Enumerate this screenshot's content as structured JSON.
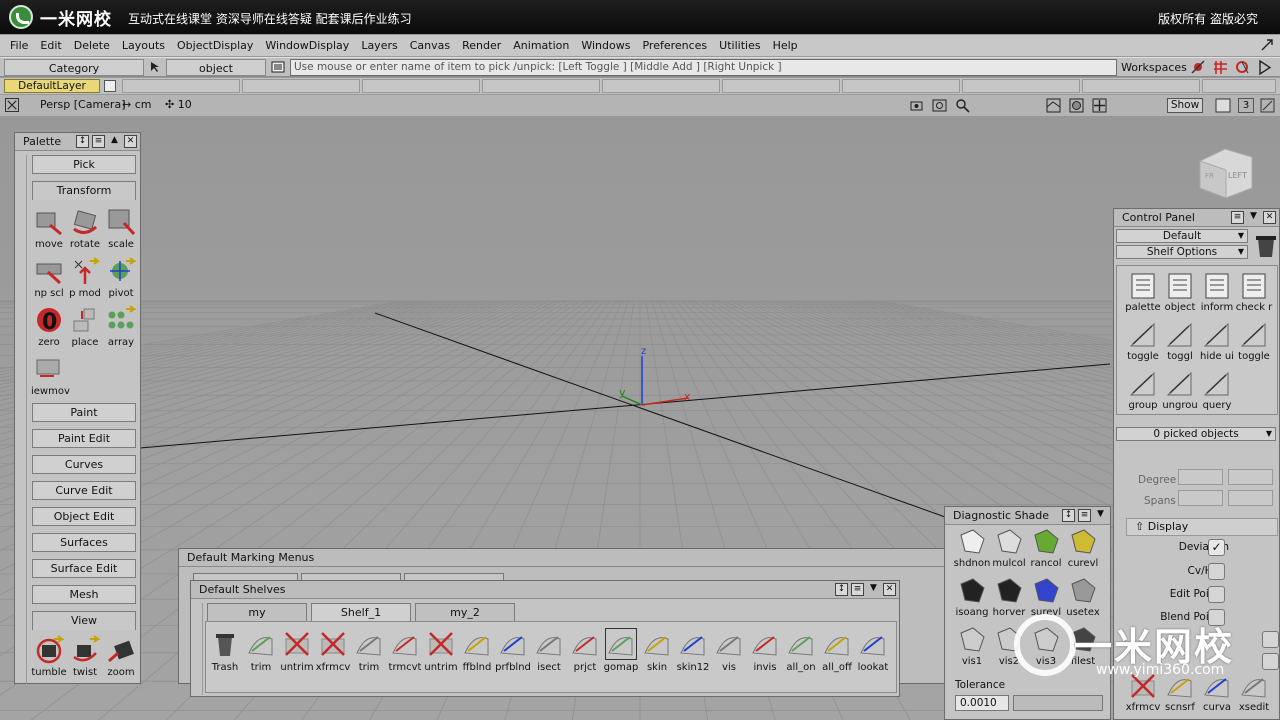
{
  "banner": {
    "brand": "一米网校",
    "slogan": "互动式在线课堂  资深导师在线答疑  配套课后作业练习",
    "copyright": "版权所有 盗版必究"
  },
  "menubar": [
    "File",
    "Edit",
    "Delete",
    "Layouts",
    "ObjectDisplay",
    "WindowDisplay",
    "Layers",
    "Canvas",
    "Render",
    "Animation",
    "Windows",
    "Preferences",
    "Utilities",
    "Help"
  ],
  "pickbar": {
    "category": "Category",
    "object": "object",
    "pick_placeholder": "Use mouse or enter name of item to pick /unpick: [Left Toggle ] [Middle Add ] [Right Unpick ]",
    "workspaces": "Workspaces"
  },
  "layerbar": {
    "default_layer": "DefaultLayer"
  },
  "viewport_header": {
    "camera": "Persp [Camera]",
    "unit": "↔ cm",
    "grid": "10",
    "show": "Show",
    "count": "3"
  },
  "viewport": {
    "axis_x": "x",
    "axis_y": "y",
    "axis_z": "z",
    "view_cube": "LEFT",
    "view_cube_side": "FR"
  },
  "palette": {
    "title": "Palette",
    "sections": {
      "pick": "Pick",
      "transform": "Transform",
      "paint": "Paint",
      "paint_edit": "Paint Edit",
      "curves": "Curves",
      "curve_edit": "Curve Edit",
      "object_edit": "Object Edit",
      "surfaces": "Surfaces",
      "surface_edit": "Surface Edit",
      "mesh": "Mesh",
      "view": "View"
    },
    "transform_tools": [
      "move",
      "rotate",
      "scale",
      "np scl",
      "p mod",
      "pivot",
      "zero",
      "place",
      "array",
      "iewmov"
    ],
    "view_tools": [
      "tumble",
      "twist",
      "zoom"
    ]
  },
  "control_panel": {
    "title": "Control Panel",
    "default": "Default",
    "shelf_options": "Shelf Options",
    "shelf_items": [
      "palette",
      "object",
      "inform",
      "check r",
      "toggle",
      "toggl",
      "hide ui",
      "toggle",
      "group",
      "ungrou",
      "query"
    ],
    "picked": "0 picked objects",
    "degree": "Degree",
    "spans": "Spans",
    "display": "Display",
    "deviation": "Deviation",
    "cv_hull": "Cv/Hull",
    "edit_points": "Edit Points",
    "blend_points": "Blend Points",
    "bottom_tools": [
      "xfrmcv",
      "scnsrf",
      "curva",
      "xsedit"
    ]
  },
  "diagnostic": {
    "title": "Diagnostic Shade",
    "items": [
      "shdnon",
      "mulcol",
      "rancol",
      "curevl",
      "isoang",
      "horver",
      "surevl",
      "usetex",
      "vis1",
      "vis2",
      "vis3",
      "filest"
    ],
    "tolerance_label": "Tolerance",
    "tolerance_value": "0.0010"
  },
  "marking_menus": {
    "title": "Default Marking Menus"
  },
  "shelves": {
    "title": "Default Shelves",
    "tabs": [
      "my",
      "Shelf_1",
      "my_2"
    ],
    "tools": [
      "Trash",
      "trim",
      "untrim",
      "xfrmcv",
      "trim",
      "trmcvt",
      "untrim",
      "ffblnd",
      "prfblnd",
      "isect",
      "prjct",
      "gomap",
      "skin",
      "skin12",
      "vis",
      "invis",
      "all_on",
      "all_off",
      "lookat"
    ]
  },
  "watermark": {
    "text": "一米网校",
    "url": "www.yimi360.com"
  },
  "colors": {
    "accent_red": "#c62828",
    "grid": "#8e8e8e",
    "layer_yellow": "#e8d87a",
    "z_axis": "#1e3fd0"
  }
}
